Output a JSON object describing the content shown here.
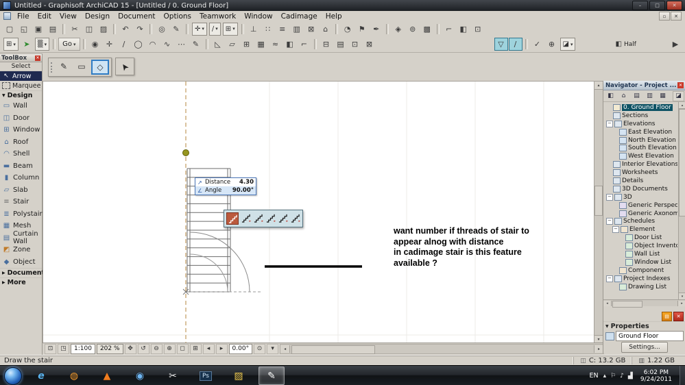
{
  "glyphs": {
    "close": "✕",
    "minimize": "–",
    "maximize": "□",
    "restore": "▫",
    "caret": "▾",
    "tri_right": "▶",
    "tri_down": "▼",
    "up": "▴",
    "down": "▾",
    "left": "◂",
    "right": "▸"
  },
  "window": {
    "title": "Untitled - Graphisoft ArchiCAD 15 - [Untitled / 0. Ground Floor]"
  },
  "menu": {
    "items": [
      "File",
      "Edit",
      "View",
      "Design",
      "Document",
      "Options",
      "Teamwork",
      "Window",
      "Cadimage",
      "Help"
    ]
  },
  "toolbar_standard": [
    {
      "name": "new-file-icon",
      "glyph": "▢"
    },
    {
      "name": "open-file-icon",
      "glyph": "◱"
    },
    {
      "name": "save-file-icon",
      "glyph": "▣"
    },
    {
      "name": "print-icon",
      "glyph": "▤"
    },
    {
      "type": "sep"
    },
    {
      "name": "cut-icon",
      "glyph": "✂"
    },
    {
      "name": "copy-icon",
      "glyph": "◫"
    },
    {
      "name": "paste-icon",
      "glyph": "▨"
    },
    {
      "type": "sep"
    },
    {
      "name": "undo-icon",
      "glyph": "↶"
    },
    {
      "name": "redo-icon",
      "glyph": "↷"
    },
    {
      "type": "sep"
    },
    {
      "name": "find-select-icon",
      "glyph": "◎"
    },
    {
      "name": "pick-up-parameters-icon",
      "glyph": "✎"
    },
    {
      "type": "sep"
    },
    {
      "type": "combo",
      "name": "mouse-constraint-combo",
      "glyph": "✛"
    },
    {
      "type": "combo",
      "name": "guide-lines-combo",
      "glyph": "∕"
    },
    {
      "type": "combo",
      "name": "snap-grid-combo",
      "glyph": "⊞"
    },
    {
      "type": "sep"
    },
    {
      "name": "gravity-icon",
      "glyph": "⊥"
    },
    {
      "name": "element-snap-icon",
      "glyph": "∷"
    },
    {
      "name": "layers-icon",
      "glyph": "≡"
    },
    {
      "name": "stories-icon",
      "glyph": "▥"
    },
    {
      "name": "marquee-options-icon",
      "glyph": "⊠"
    },
    {
      "name": "home-story-icon",
      "glyph": "⌂"
    },
    {
      "type": "sep"
    },
    {
      "name": "quick-options-icon",
      "glyph": "◔"
    },
    {
      "name": "markup-tools-icon",
      "glyph": "⚑"
    },
    {
      "name": "pen-sets-icon",
      "glyph": "✒"
    },
    {
      "type": "sep"
    },
    {
      "name": "library-manager-icon",
      "glyph": "◈"
    },
    {
      "name": "camera-icon",
      "glyph": "⊚"
    },
    {
      "name": "render-icon",
      "glyph": "▩"
    },
    {
      "type": "sep"
    },
    {
      "name": "profile-manager-icon",
      "glyph": "⌐"
    },
    {
      "name": "model-view-icon",
      "glyph": "◧"
    },
    {
      "name": "work-environment-icon",
      "glyph": "⊡"
    }
  ],
  "toolbar_main": [
    {
      "type": "combo",
      "name": "element-settings-combo",
      "glyph": "⊞"
    },
    {
      "name": "confirm-icon",
      "glyph": "➤",
      "color": "#2e8b2e"
    },
    {
      "type": "combo",
      "name": "selection-options-combo",
      "glyph": "▒"
    },
    {
      "type": "sep"
    },
    {
      "type": "go",
      "name": "go-button",
      "label": "Go"
    },
    {
      "type": "sep"
    },
    {
      "name": "favorites-icon",
      "glyph": "◉"
    },
    {
      "name": "snap-point-icon",
      "glyph": "✛"
    },
    {
      "name": "line-tool-icon",
      "glyph": "∕"
    },
    {
      "name": "circle-tool-icon",
      "glyph": "◯"
    },
    {
      "name": "arc-tool-icon",
      "glyph": "◠"
    },
    {
      "name": "spline-tool-icon",
      "glyph": "∿"
    },
    {
      "name": "more-tools-icon",
      "glyph": "⋯"
    },
    {
      "name": "annotation-icon",
      "glyph": "✎"
    },
    {
      "type": "sep"
    },
    {
      "name": "triangle-tool-icon",
      "glyph": "◺"
    },
    {
      "name": "polygon-tool-icon",
      "glyph": "▱"
    },
    {
      "name": "grid-tool-icon",
      "glyph": "⊞"
    },
    {
      "name": "mesh-icon",
      "glyph": "▦"
    },
    {
      "name": "terrain-icon",
      "glyph": "≈"
    },
    {
      "name": "fill-icon",
      "glyph": "◧"
    },
    {
      "name": "corner-icon",
      "glyph": "⌐"
    },
    {
      "type": "sep"
    },
    {
      "name": "subtract-icon",
      "glyph": "⊟"
    },
    {
      "name": "rows-icon",
      "glyph": "▤"
    },
    {
      "name": "frame-icon",
      "glyph": "⊡"
    },
    {
      "name": "cross-icon",
      "glyph": "⊠"
    },
    {
      "type": "space",
      "w": 170
    },
    {
      "name": "gravity-magnet-icon",
      "glyph": "▽",
      "active": true
    },
    {
      "name": "guide-segment-icon",
      "glyph": "∕",
      "active": true
    },
    {
      "type": "sep"
    },
    {
      "name": "check-icon",
      "glyph": "✓"
    },
    {
      "name": "add-icon",
      "glyph": "⊕"
    },
    {
      "type": "combo",
      "name": "view-options-combo",
      "glyph": "◪"
    },
    {
      "type": "space",
      "w": 55
    },
    {
      "type": "labelled",
      "name": "trace-reference-toggle",
      "glyph": "◧",
      "label": "Half"
    },
    {
      "name": "play-icon",
      "glyph": "▶",
      "push": true
    }
  ],
  "toolbox": {
    "title": "ToolBox",
    "select_label": "Select",
    "tools": [
      {
        "label": "Arrow",
        "glyph": "↖",
        "selected": true
      },
      {
        "label": "Marquee",
        "icon": "dashed"
      }
    ],
    "sections": [
      {
        "label": "Design",
        "expanded": true,
        "items": [
          {
            "label": "Wall",
            "glyph": "▭",
            "color": "#4a6f9e"
          },
          {
            "label": "Door",
            "glyph": "◫",
            "color": "#4a6f9e"
          },
          {
            "label": "Window",
            "glyph": "⊞",
            "color": "#4a6f9e"
          },
          {
            "label": "Roof",
            "glyph": "⌂",
            "color": "#4a6f9e"
          },
          {
            "label": "Shell",
            "glyph": "◠",
            "color": "#4a6f9e"
          },
          {
            "label": "Beam",
            "glyph": "▬",
            "color": "#4a6f9e"
          },
          {
            "label": "Column",
            "glyph": "▮",
            "color": "#4a6f9e"
          },
          {
            "label": "Slab",
            "glyph": "▱",
            "color": "#4a6f9e"
          },
          {
            "label": "Stair",
            "glyph": "≡",
            "color": "#6f6f6f"
          },
          {
            "label": "Polystair",
            "glyph": "≣",
            "color": "#4a6f9e"
          },
          {
            "label": "Mesh",
            "glyph": "▦",
            "color": "#4a6f9e"
          },
          {
            "label": "Curtain Wall",
            "glyph": "▤",
            "color": "#4a6f9e"
          },
          {
            "label": "Zone",
            "glyph": "◩",
            "color": "#c07a28"
          },
          {
            "label": "Object",
            "glyph": "◆",
            "color": "#4a6f9e"
          }
        ]
      },
      {
        "label": "Document",
        "expanded": false,
        "items": []
      },
      {
        "label": "More",
        "expanded": false,
        "items": []
      }
    ]
  },
  "canvas": {
    "method_bar": {
      "icons": [
        {
          "name": "pen-method-icon",
          "glyph": "✎"
        },
        {
          "name": "rect-method-icon",
          "glyph": "▭"
        },
        {
          "name": "rotated-rect-method-icon",
          "glyph": "◇",
          "selected": true
        }
      ]
    },
    "arrow_bar": {
      "glyph": "➤"
    },
    "tracker": {
      "rows": [
        {
          "glyph": "↗",
          "label": "Distance",
          "value": "4.30"
        },
        {
          "glyph": "∠",
          "label": "Angle",
          "value": "90.00°"
        }
      ]
    },
    "pet_palette": {
      "items": [
        {
          "name": "stair-selected-icon",
          "selected": true
        },
        {
          "name": "stair-run-icon"
        },
        {
          "name": "stair-turn-icon"
        },
        {
          "name": "stair-double-turn-icon"
        },
        {
          "name": "stair-landing-icon"
        },
        {
          "name": "stair-custom-icon"
        }
      ]
    },
    "note_lines": [
      "want number if threads of stair to",
      "appear alnog with distance",
      "in cadimage stair is this feature",
      "available ?"
    ]
  },
  "canvasbar": {
    "items": [
      {
        "name": "layout-mode-icon",
        "glyph": "⊡"
      },
      {
        "name": "view-mode-icon",
        "glyph": "◳"
      },
      {
        "type": "box",
        "name": "scale-display",
        "label": "1:100"
      },
      {
        "type": "box",
        "name": "zoom-display",
        "label": "202 %",
        "shaded": true
      },
      {
        "name": "pan-icon",
        "glyph": "✥"
      },
      {
        "name": "orbit-icon",
        "glyph": "↺"
      },
      {
        "name": "zoom-out-icon",
        "glyph": "⊖"
      },
      {
        "name": "zoom-in-icon",
        "glyph": "⊕"
      },
      {
        "name": "zoom-window-icon",
        "glyph": "◻"
      },
      {
        "name": "fit-in-window-icon",
        "glyph": "⊞"
      },
      {
        "name": "previous-view-icon",
        "glyph": "◂"
      },
      {
        "name": "next-view-icon",
        "glyph": "▸"
      },
      {
        "type": "box",
        "name": "rotation-display",
        "label": "0.00°"
      },
      {
        "name": "orientation-icon",
        "glyph": "⊙"
      },
      {
        "name": "more-options-icon",
        "glyph": "▾"
      }
    ]
  },
  "navigator": {
    "title": "Navigator - Project ...",
    "toolbar": [
      {
        "name": "project-chooser-icon",
        "glyph": "◧"
      },
      {
        "name": "project-map-icon",
        "glyph": "⌂"
      },
      {
        "name": "view-map-icon",
        "glyph": "▤"
      },
      {
        "name": "layout-book-icon",
        "glyph": "▥"
      },
      {
        "name": "publisher-sets-icon",
        "glyph": "▦"
      },
      {
        "name": "navigator-options-icon",
        "glyph": "◪",
        "right": true
      }
    ],
    "tree": [
      {
        "label": "0. Ground Floor",
        "depth": 1,
        "selected": true,
        "icon": "story"
      },
      {
        "label": "Sections",
        "depth": 1,
        "icon": "folder"
      },
      {
        "label": "Elevations",
        "depth": 1,
        "expander": "-",
        "icon": "folder"
      },
      {
        "label": "East Elevation",
        "depth": 2,
        "icon": "view"
      },
      {
        "label": "North Elevation",
        "depth": 2,
        "icon": "view"
      },
      {
        "label": "South Elevation",
        "depth": 2,
        "icon": "view"
      },
      {
        "label": "West Elevation",
        "depth": 2,
        "icon": "view"
      },
      {
        "label": "Interior Elevations",
        "depth": 1,
        "icon": "folder"
      },
      {
        "label": "Worksheets",
        "depth": 1,
        "icon": "folder"
      },
      {
        "label": "Details",
        "depth": 1,
        "icon": "folder"
      },
      {
        "label": "3D Documents",
        "depth": 1,
        "icon": "folder"
      },
      {
        "label": "3D",
        "depth": 1,
        "expander": "-",
        "icon": "folder"
      },
      {
        "label": "Generic Perspective",
        "depth": 2,
        "icon": "camera"
      },
      {
        "label": "Generic Axonometry",
        "depth": 2,
        "icon": "camera"
      },
      {
        "label": "Schedules",
        "depth": 1,
        "expander": "-",
        "icon": "folder"
      },
      {
        "label": "Element",
        "depth": 2,
        "expander": "-",
        "icon": "schedule"
      },
      {
        "label": "Door List",
        "depth": 3,
        "icon": "list"
      },
      {
        "label": "Object Inventory",
        "depth": 3,
        "icon": "list"
      },
      {
        "label": "Wall List",
        "depth": 3,
        "icon": "list"
      },
      {
        "label": "Window List",
        "depth": 3,
        "icon": "list"
      },
      {
        "label": "Component",
        "depth": 2,
        "icon": "schedule"
      },
      {
        "label": "Project Indexes",
        "depth": 1,
        "expander": "-",
        "icon": "folder"
      },
      {
        "label": "Drawing List",
        "depth": 2,
        "icon": "list"
      }
    ],
    "properties": {
      "header": "Properties",
      "level_value": "Ground Floor",
      "settings_label": "Settings..."
    }
  },
  "statusbar": {
    "message": "Draw the stair",
    "segments": [
      {
        "name": "disk-space",
        "glyph": "◫",
        "label": "C: 13.2 GB"
      },
      {
        "name": "memory",
        "glyph": "▥",
        "label": "1.22 GB"
      }
    ]
  },
  "taskbar": {
    "apps": [
      {
        "name": "internet-explorer-icon",
        "glyph": "e",
        "color": "#5ab4f0",
        "italic": true
      },
      {
        "name": "firefox-icon",
        "glyph": "◍",
        "color": "#f59b2d"
      },
      {
        "name": "vlc-icon",
        "glyph": "▲",
        "color": "#f07c1e"
      },
      {
        "name": "media-player-icon",
        "glyph": "◉",
        "color": "#6db5f2"
      },
      {
        "name": "snipping-tool-icon",
        "glyph": "✂",
        "color": "#e8e8e8"
      },
      {
        "name": "photoshop-icon",
        "glyph": "Ps",
        "box": true
      },
      {
        "name": "documents-folder-icon",
        "glyph": "▨",
        "color": "#ecc84e"
      },
      {
        "name": "archicad-icon",
        "glyph": "✎",
        "color": "#ffffff",
        "active": true
      }
    ],
    "tray": {
      "lang": "EN",
      "icons": [
        {
          "name": "show-hidden-icons",
          "glyph": "▴"
        },
        {
          "name": "action-center-icon",
          "glyph": "⚐"
        },
        {
          "name": "volume-icon",
          "glyph": "♪"
        },
        {
          "name": "network-icon",
          "glyph": "▟"
        }
      ],
      "time": "6:02 PM",
      "date": "9/24/2011"
    }
  }
}
